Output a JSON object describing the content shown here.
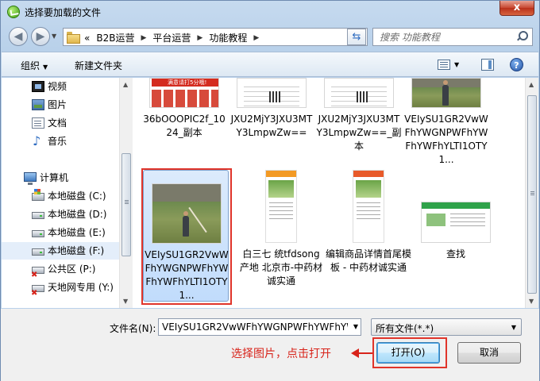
{
  "window": {
    "title": "选择要加载的文件",
    "close_label": "x"
  },
  "address": {
    "crumbs": [
      "B2B运营",
      "平台运营",
      "功能教程"
    ],
    "prefix": "«",
    "search_placeholder": "搜索 功能教程"
  },
  "toolbar": {
    "organize": "组织",
    "new_folder": "新建文件夹",
    "help": "?"
  },
  "nav": {
    "libraries": [
      {
        "label": "视频",
        "icon": "video-icon"
      },
      {
        "label": "图片",
        "icon": "pictures-icon"
      },
      {
        "label": "文档",
        "icon": "documents-icon"
      },
      {
        "label": "音乐",
        "icon": "music-icon"
      }
    ],
    "computer": "计算机",
    "drives": [
      {
        "label": "本地磁盘 (C:)",
        "icon": "system-disk-icon"
      },
      {
        "label": "本地磁盘 (D:)",
        "icon": "disk-icon"
      },
      {
        "label": "本地磁盘 (E:)",
        "icon": "disk-icon"
      },
      {
        "label": "本地磁盘 (F:)",
        "icon": "disk-icon",
        "selected": true
      },
      {
        "label": "公共区 (P:)",
        "icon": "network-disk-icon"
      },
      {
        "label": "天地网专用 (Y:)",
        "icon": "network-disk-icon"
      }
    ]
  },
  "files": [
    {
      "name": "36bOOOPIC2f_1024_副本",
      "thumb": "ad-banner"
    },
    {
      "name": "JXU2MjY3JXU3MTY3LmpwZw==",
      "thumb": "document-qr"
    },
    {
      "name": "JXU2MjY3JXU3MTY3LmpwZw==_副本",
      "thumb": "document-qr"
    },
    {
      "name": "VEIySU1GR2VwWFhYWGNPWFhYWFhYWFhYLTI1OTY1...",
      "thumb": "field-photo"
    },
    {
      "name": "VEIySU1GR2VwWFhYWGNPWFhYWFhYWFhYLTI1OTY1...",
      "thumb": "field-photo",
      "selected": true
    },
    {
      "name": "白三七 统tfdsong 产地 北京市-中药材诚实通",
      "thumb": "phone-page"
    },
    {
      "name": "编辑商品详情首尾模板 - 中药材诚实通",
      "thumb": "phone-page"
    },
    {
      "name": "查找",
      "thumb": "website-page"
    }
  ],
  "thumb_texts": {
    "banner": "满意请打5分哦!"
  },
  "bottom": {
    "filename_label": "文件名(N):",
    "filename_value": "VEIySU1GR2VwWFhYWGNPWFhYWFhYW",
    "filetype_value": "所有文件(*.*)",
    "hint": "选择图片，点击打开",
    "open_label": "打开(O)",
    "cancel_label": "取消"
  },
  "colors": {
    "annotation": "#e0342a",
    "selection": "#c1dcfc",
    "chrome": "#b9d1ea"
  }
}
